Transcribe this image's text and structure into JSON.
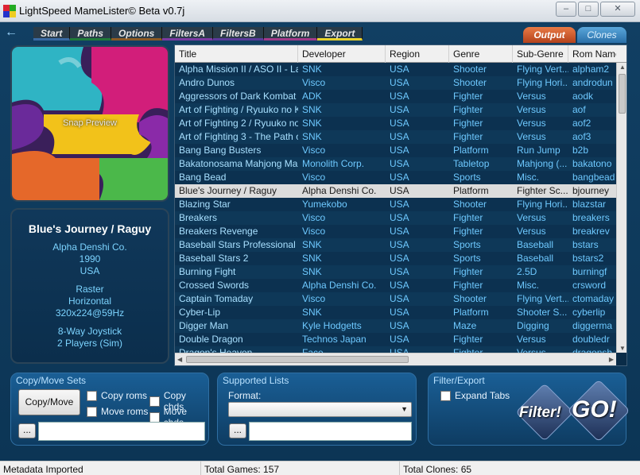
{
  "window": {
    "title": "LightSpeed MameLister© Beta v0.7j",
    "minimize_icon": "minimize-icon",
    "maximize_icon": "maximize-icon",
    "close_icon": "close-icon"
  },
  "menu": {
    "back_icon": "back-arrow-icon",
    "items": [
      "Start",
      "Paths",
      "Options",
      "FiltersA",
      "FiltersB",
      "Platform",
      "Export"
    ],
    "output_label": "Output",
    "clones_label": "Clones"
  },
  "snap": {
    "label": "Snap Preview"
  },
  "info": {
    "title": "Blue's Journey / Raguy",
    "developer": "Alpha Denshi Co.",
    "year": "1990",
    "region": "USA",
    "display_type": "Raster",
    "orientation": "Horizontal",
    "resolution": "320x224@59Hz",
    "controls": "8-Way Joystick",
    "players": "2 Players (Sim)"
  },
  "table": {
    "columns": [
      "Title",
      "Developer",
      "Region",
      "Genre",
      "Sub-Genre",
      "Rom Name"
    ],
    "selected_index": 9,
    "rows": [
      [
        "Alpha Mission II / ASO II - La...",
        "SNK",
        "USA",
        "Shooter",
        "Flying Vert...",
        "alpham2"
      ],
      [
        "Andro Dunos",
        "Visco",
        "USA",
        "Shooter",
        "Flying Hori...",
        "androdun"
      ],
      [
        "Aggressors of Dark Kombat /...",
        "ADK",
        "USA",
        "Fighter",
        "Versus",
        "aodk"
      ],
      [
        "Art of Fighting / Ryuuko no K...",
        "SNK",
        "USA",
        "Fighter",
        "Versus",
        "aof"
      ],
      [
        "Art of Fighting 2 / Ryuuko no...",
        "SNK",
        "USA",
        "Fighter",
        "Versus",
        "aof2"
      ],
      [
        "Art of Fighting 3 - The Path o...",
        "SNK",
        "USA",
        "Fighter",
        "Versus",
        "aof3"
      ],
      [
        "Bang Bang Busters",
        "Visco",
        "USA",
        "Platform",
        "Run Jump",
        "b2b"
      ],
      [
        "Bakatonosama Mahjong Ma...",
        "Monolith Corp.",
        "USA",
        "Tabletop",
        "Mahjong (...",
        "bakatono"
      ],
      [
        "Bang Bead",
        "Visco",
        "USA",
        "Sports",
        "Misc.",
        "bangbead"
      ],
      [
        "Blue's Journey / Raguy",
        "Alpha Denshi Co.",
        "USA",
        "Platform",
        "Fighter Sc...",
        "bjourney"
      ],
      [
        "Blazing Star",
        "Yumekobo",
        "USA",
        "Shooter",
        "Flying Hori...",
        "blazstar"
      ],
      [
        "Breakers",
        "Visco",
        "USA",
        "Fighter",
        "Versus",
        "breakers"
      ],
      [
        "Breakers Revenge",
        "Visco",
        "USA",
        "Fighter",
        "Versus",
        "breakrev"
      ],
      [
        "Baseball Stars Professional",
        "SNK",
        "USA",
        "Sports",
        "Baseball",
        "bstars"
      ],
      [
        "Baseball Stars 2",
        "SNK",
        "USA",
        "Sports",
        "Baseball",
        "bstars2"
      ],
      [
        "Burning Fight",
        "SNK",
        "USA",
        "Fighter",
        "2.5D",
        "burningf"
      ],
      [
        "Crossed Swords",
        "Alpha Denshi Co.",
        "USA",
        "Fighter",
        "Misc.",
        "crsword"
      ],
      [
        "Captain Tomaday",
        "Visco",
        "USA",
        "Shooter",
        "Flying Vert...",
        "ctomaday"
      ],
      [
        "Cyber-Lip",
        "SNK",
        "USA",
        "Platform",
        "Shooter S...",
        "cyberlip"
      ],
      [
        "Digger Man",
        "Kyle Hodgetts",
        "USA",
        "Maze",
        "Digging",
        "diggerma"
      ],
      [
        "Double Dragon",
        "Technos Japan",
        "USA",
        "Fighter",
        "Versus",
        "doubledr"
      ],
      [
        "Dragon's Heaven",
        "Face",
        "USA",
        "Fighter",
        "Versus",
        "dragonsh"
      ]
    ]
  },
  "copy_move": {
    "title": "Copy/Move Sets",
    "button_label": "Copy/Move",
    "copy_roms": "Copy roms",
    "copy_chds": "Copy chds",
    "move_roms": "Move roms",
    "move_chds": "Move chds",
    "browse_label": "...",
    "path_value": ""
  },
  "supported_lists": {
    "title": "Supported Lists",
    "format_label": "Format:",
    "format_value": "",
    "browse_label": "...",
    "path_value": ""
  },
  "filter_export": {
    "title": "Filter/Export",
    "expand_tabs": "Expand Tabs",
    "filter_label": "Filter!",
    "go_label": "GO!"
  },
  "status": {
    "message": "Metadata Imported",
    "total_games": "Total Games: 157",
    "total_clones": "Total Clones: 65"
  },
  "colors": {
    "accent_output": "#d0582a",
    "accent_clones": "#3a86c2",
    "row_text": "#6ec9ff",
    "background": "#0f3a5c"
  }
}
